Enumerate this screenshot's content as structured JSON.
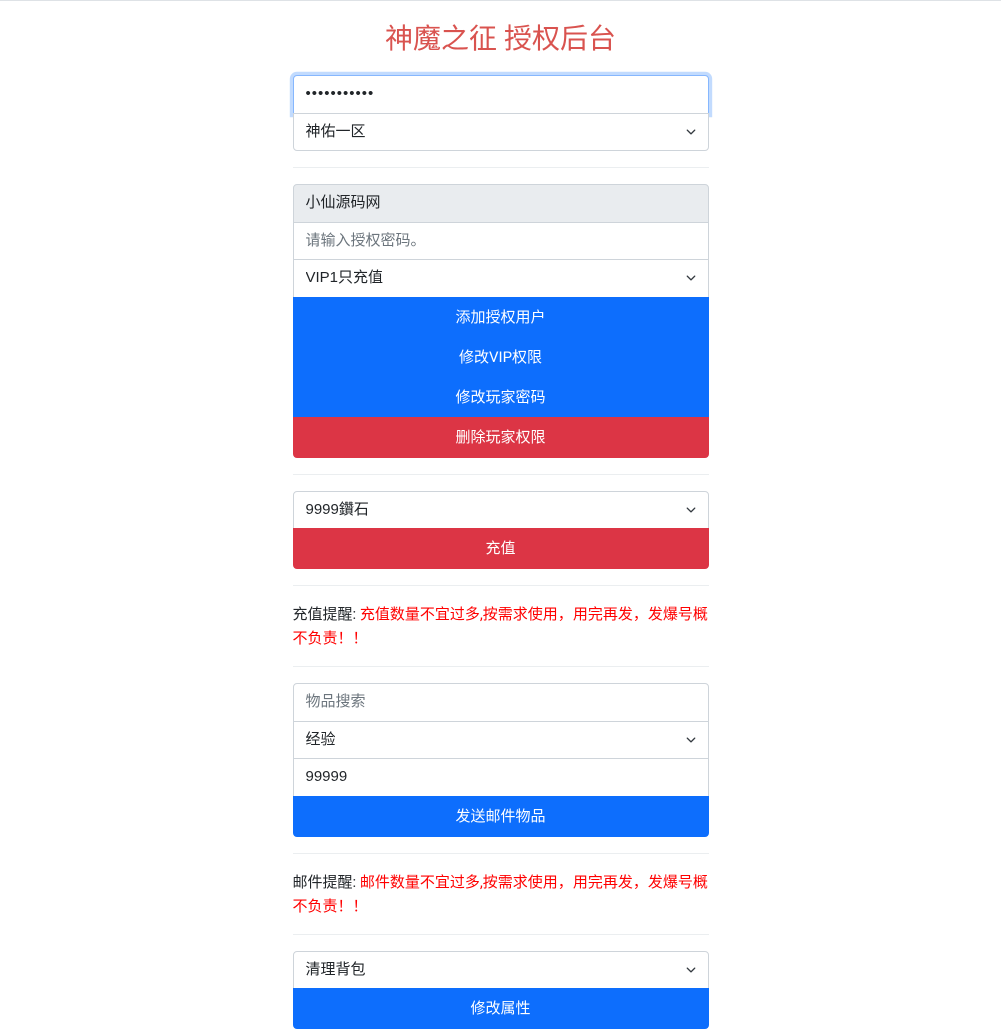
{
  "title": "神魔之征 授权后台",
  "section1": {
    "password_value": "•••••••••••",
    "server_select": "神佑一区"
  },
  "section2": {
    "username_value": "小仙源码网",
    "password_placeholder": "请输入授权密码。",
    "vip_select": "VIP1只充值",
    "btn_add_user": "添加授权用户",
    "btn_modify_vip": "修改VIP权限",
    "btn_modify_password": "修改玩家密码",
    "btn_delete_permission": "删除玩家权限"
  },
  "section3": {
    "recharge_select": "9999鑽石",
    "btn_recharge": "充值"
  },
  "notice1": {
    "label": "充值提醒: ",
    "text": "充值数量不宜过多,按需求使用，用完再发，发爆号概不负责！！"
  },
  "section4": {
    "item_search_placeholder": "物品搜索",
    "item_select": "经验",
    "quantity_value": "99999",
    "btn_send_mail": "发送邮件物品"
  },
  "notice2": {
    "label": "邮件提醒: ",
    "text": "邮件数量不宜过多,按需求使用，用完再发，发爆号概不负责！！"
  },
  "section5": {
    "action_select": "清理背包",
    "btn_modify_attr": "修改属性"
  }
}
